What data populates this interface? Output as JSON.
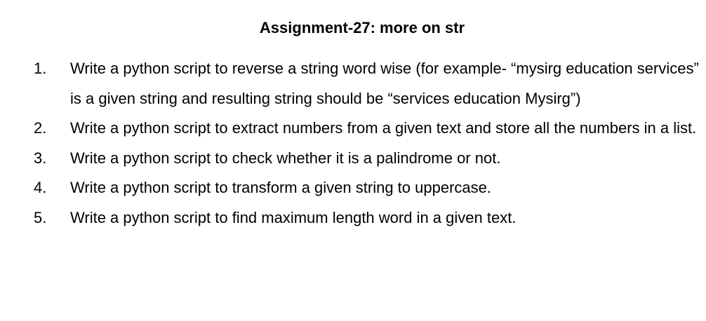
{
  "document": {
    "title": "Assignment-27: more on str",
    "items": [
      {
        "number": "1.",
        "text": "Write a python script to reverse a string word wise (for example- “mysirg education services” is a given string and resulting string should be “services education Mysirg”)"
      },
      {
        "number": "2.",
        "text": "Write a python script to extract numbers from a given text and store all the numbers in a list."
      },
      {
        "number": "3.",
        "text": "Write a python script to check whether it is a palindrome or not."
      },
      {
        "number": "4.",
        "text": "Write a python script to transform a given string to uppercase."
      },
      {
        "number": "5.",
        "text": "Write a python script to find maximum length word in a given text."
      }
    ]
  }
}
